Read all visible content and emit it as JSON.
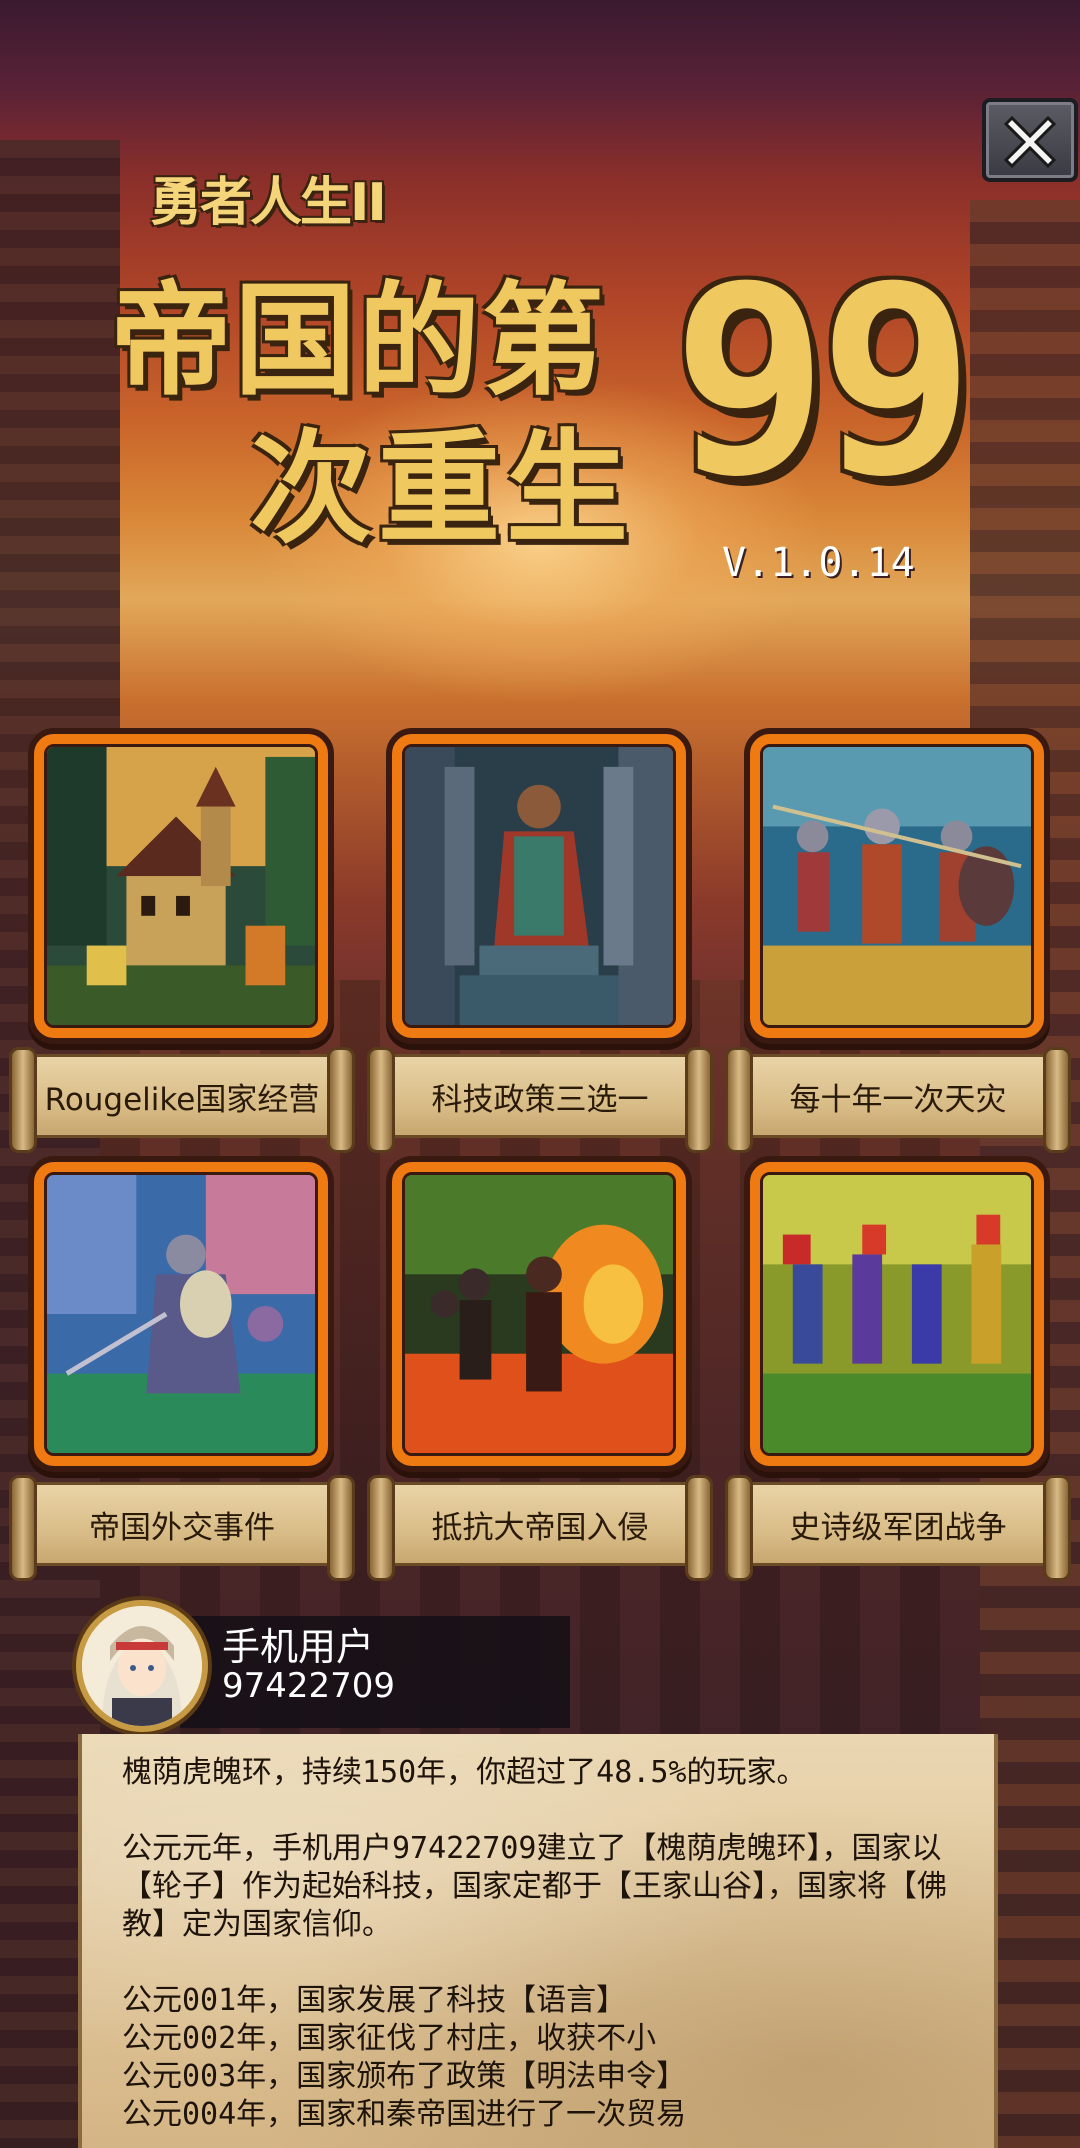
{
  "header": {
    "subtitle": "勇者人生II",
    "title_line1": "帝国的第",
    "title_line2": "次重生",
    "title_number": "99",
    "version": "V.1.0.14"
  },
  "close_button": {
    "icon": "close-icon"
  },
  "features": [
    {
      "label": "Rougelike国家经营",
      "art": "medieval-village"
    },
    {
      "label": "科技政策三选一",
      "art": "statue"
    },
    {
      "label": "每十年一次天灾",
      "art": "marching-soldiers"
    },
    {
      "label": "帝国外交事件",
      "art": "knight"
    },
    {
      "label": "抵抗大帝国入侵",
      "art": "burning-battle"
    },
    {
      "label": "史诗级军团战争",
      "art": "army-legion"
    }
  ],
  "user": {
    "name": "手机用户",
    "id": "97422709"
  },
  "log": {
    "summary": "槐荫虎魄环，持续150年，你超过了48.5%的玩家。",
    "founding": "公元元年，手机用户97422709建立了【槐荫虎魄环】，国家以【轮子】作为起始科技，国家定都于【王家山谷】，国家将【佛教】定为国家信仰。",
    "events": [
      "公元001年，国家发展了科技【语言】",
      "公元002年，国家征伐了村庄，收获不小",
      "公元003年，国家颁布了政策【明法申令】",
      "公元004年，国家和秦帝国进行了一次贸易"
    ]
  }
}
